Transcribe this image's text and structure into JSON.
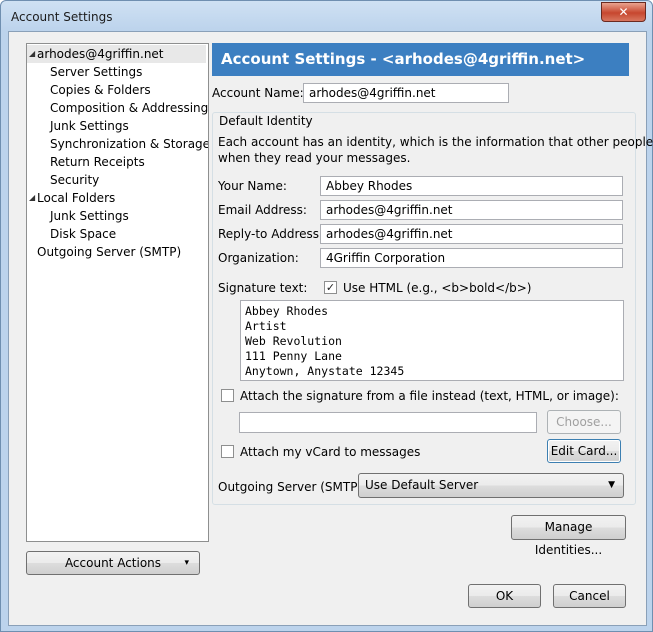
{
  "window": {
    "title": "Account Settings",
    "close_label": "✕"
  },
  "tree": {
    "items": [
      {
        "label": "arhodes@4griffin.net",
        "level": 0,
        "expanded": true,
        "selected": true
      },
      {
        "label": "Server Settings",
        "level": 1
      },
      {
        "label": "Copies & Folders",
        "level": 1
      },
      {
        "label": "Composition & Addressing",
        "level": 1
      },
      {
        "label": "Junk Settings",
        "level": 1
      },
      {
        "label": "Synchronization & Storage",
        "level": 1
      },
      {
        "label": "Return Receipts",
        "level": 1
      },
      {
        "label": "Security",
        "level": 1
      },
      {
        "label": "Local Folders",
        "level": 0,
        "expanded": true
      },
      {
        "label": "Junk Settings",
        "level": 1
      },
      {
        "label": "Disk Space",
        "level": 1
      },
      {
        "label": "Outgoing Server (SMTP)",
        "level": 0
      }
    ]
  },
  "account_actions": {
    "label": "Account Actions",
    "arrow": "▾"
  },
  "header": {
    "title": "Account Settings - <arhodes@4griffin.net>"
  },
  "account_name": {
    "label": "Account Name:",
    "value": "arhodes@4griffin.net"
  },
  "default_identity": {
    "title": "Default Identity",
    "description_1": "Each account has an identity, which is the information that other people see",
    "description_2": "when they read your messages.",
    "your_name": {
      "label": "Your Name:",
      "value": "Abbey Rhodes"
    },
    "email": {
      "label": "Email Address:",
      "value": "arhodes@4griffin.net"
    },
    "reply_to": {
      "label": "Reply-to Address:",
      "value": "arhodes@4griffin.net"
    },
    "organization": {
      "label": "Organization:",
      "value": "4Griffin Corporation"
    },
    "signature_label": "Signature text:",
    "use_html": {
      "label": "Use HTML (e.g., <b>bold</b>)",
      "checked": true,
      "check_glyph": "✓"
    },
    "signature_lines": [
      "Abbey Rhodes",
      "Artist",
      "Web Revolution",
      "111 Penny Lane",
      "Anytown, Anystate 12345"
    ],
    "attach_signature": {
      "label": "Attach the signature from a file instead (text, HTML, or image):",
      "checked": false
    },
    "signature_file_value": "",
    "choose_button": "Choose...",
    "attach_vcard": {
      "label": "Attach my vCard to messages",
      "checked": false
    },
    "edit_card_button": "Edit Card...",
    "outgoing_server": {
      "label": "Outgoing Server (SMTP):",
      "value": "Use Default Server",
      "arrow": "▼"
    }
  },
  "manage_identities_button": "Manage Identities...",
  "ok_button": "OK",
  "cancel_button": "Cancel"
}
